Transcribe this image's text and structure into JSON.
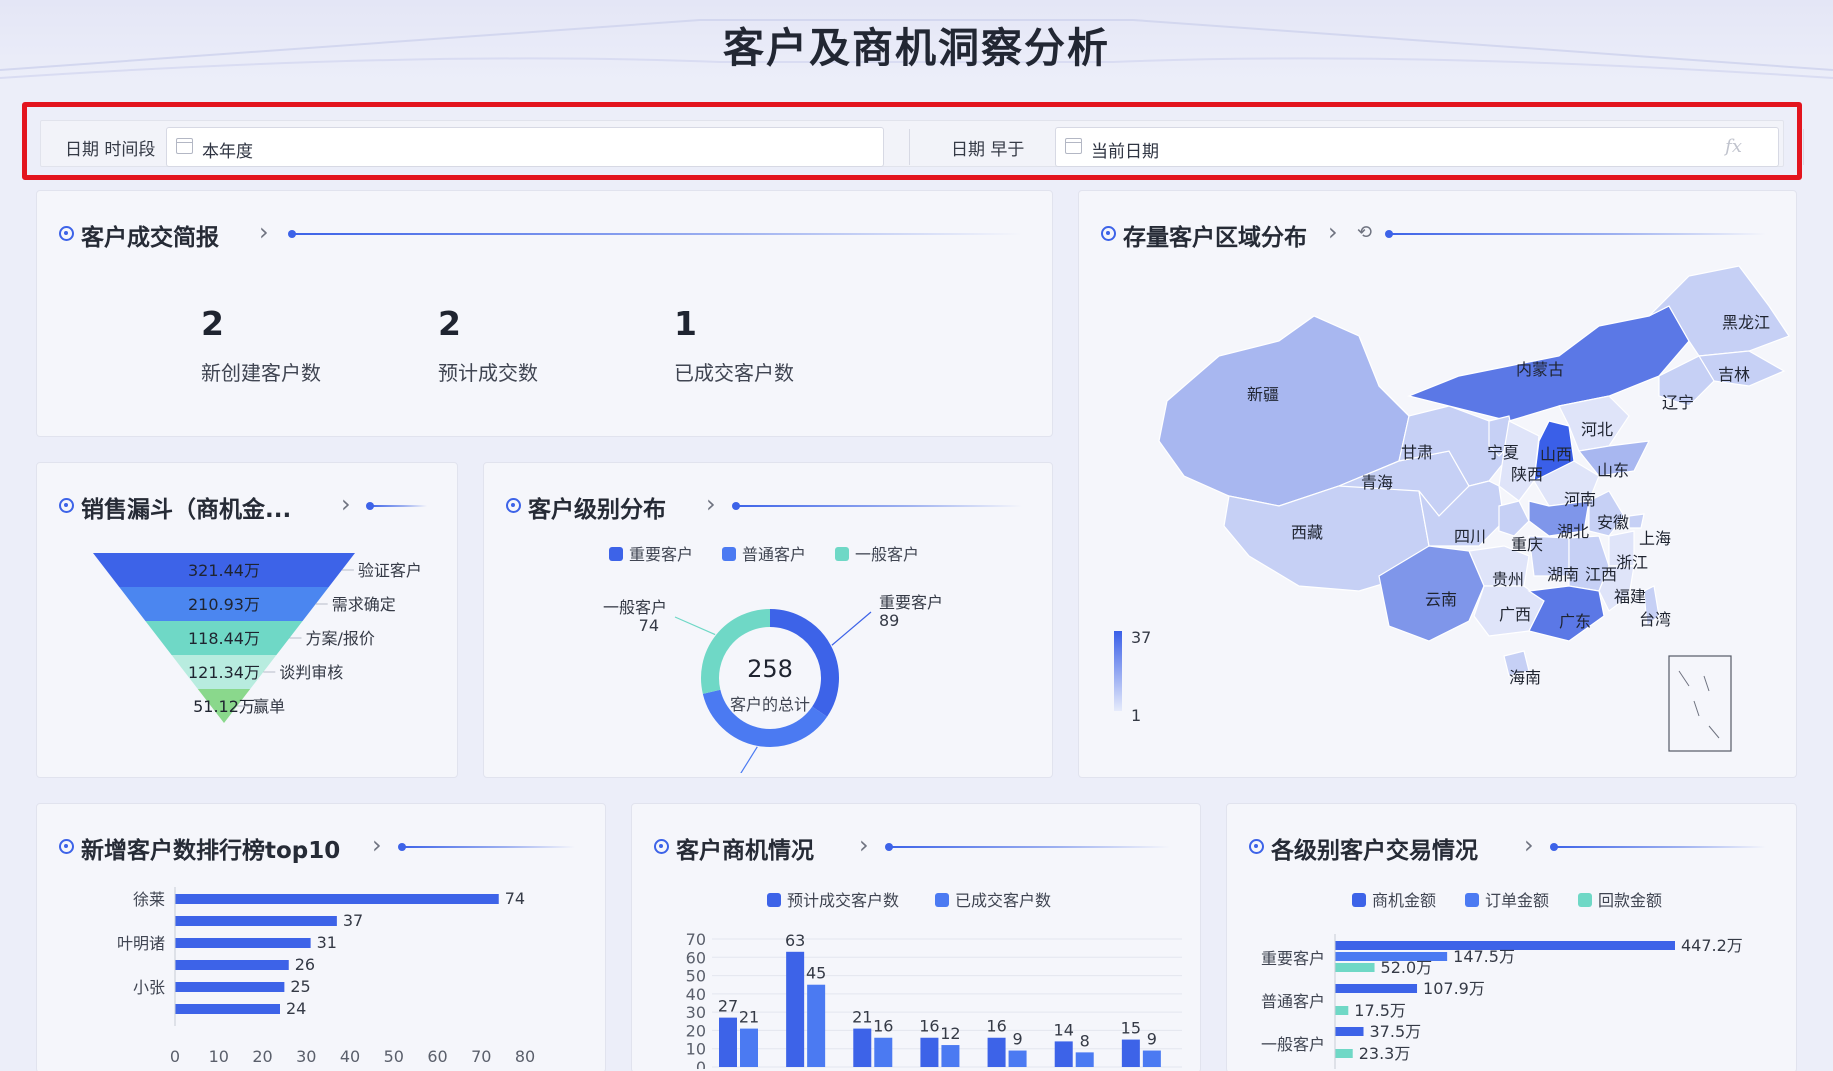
{
  "page": {
    "title": "客户及商机洞察分析"
  },
  "filters": {
    "period_label": "日期 时间段",
    "period_value": "本年度",
    "before_label": "日期 早于",
    "before_value": "当前日期",
    "fx_label": "fx"
  },
  "summary": {
    "title": "客户成交简报",
    "stats": [
      {
        "value": "2",
        "label": "新创建客户数"
      },
      {
        "value": "2",
        "label": "预计成交数"
      },
      {
        "value": "1",
        "label": "已成交客户数"
      }
    ]
  },
  "region": {
    "title": "存量客户区域分布",
    "legend_max": "37",
    "legend_min": "1",
    "provinces": [
      "黑龙江",
      "吉林",
      "辽宁",
      "内蒙古",
      "新疆",
      "河北",
      "山西",
      "山东",
      "甘肃",
      "宁夏",
      "陕西",
      "青海",
      "河南",
      "西藏",
      "四川",
      "重庆",
      "湖北",
      "安徽",
      "上海",
      "浙江",
      "江西",
      "湖南",
      "贵州",
      "云南",
      "广西",
      "广东",
      "福建",
      "台湾",
      "海南"
    ]
  },
  "colors": {
    "accent": "#3d63e8",
    "mid": "#4b7af2",
    "teal": "#6fd8c6",
    "red_frame": "#e3141e"
  },
  "chart_data": [
    {
      "type": "funnel",
      "title": "销售漏斗（商机金...",
      "categories": [
        "验证客户",
        "需求确定",
        "方案/报价",
        "谈判审核",
        "赢单"
      ],
      "value_labels": [
        "321.44万",
        "210.93万",
        "118.44万",
        "121.34万",
        "51.12万"
      ],
      "values": [
        321.44,
        210.93,
        118.44,
        121.34,
        51.12
      ]
    },
    {
      "type": "pie",
      "title": "客户级别分布",
      "categories": [
        "重要客户",
        "普通客户",
        "一般客户"
      ],
      "values": [
        89,
        95,
        74
      ],
      "center_value": "258",
      "center_label": "客户的总计"
    },
    {
      "type": "bar",
      "orientation": "horizontal",
      "title": "新增客户数排行榜top10",
      "categories": [
        "徐莱",
        "",
        "叶明诸",
        "",
        "小张",
        ""
      ],
      "values": [
        74,
        37,
        31,
        26,
        25,
        24
      ],
      "xlim": [
        0,
        80
      ],
      "xticks": [
        "0",
        "10",
        "20",
        "30",
        "40",
        "50",
        "60",
        "70",
        "80"
      ]
    },
    {
      "type": "bar",
      "title": "客户商机情况",
      "ylim": [
        0,
        70
      ],
      "yticks": [
        "70",
        "60",
        "50",
        "40",
        "30",
        "20",
        "10",
        "0"
      ],
      "series": [
        {
          "name": "预计成交客户数",
          "values": [
            27,
            63,
            21,
            16,
            16,
            14,
            15
          ]
        },
        {
          "name": "已成交客户数",
          "values": [
            21,
            45,
            16,
            12,
            9,
            8,
            9
          ]
        }
      ]
    },
    {
      "type": "bar",
      "orientation": "horizontal",
      "title": "各级别客户交易情况",
      "categories": [
        "重要客户",
        "普通客户",
        "一般客户"
      ],
      "series": [
        {
          "name": "商机金额",
          "values": [
            447.2,
            107.9,
            37.5
          ],
          "labels": [
            "447.2万",
            "107.9万",
            "37.5万"
          ]
        },
        {
          "name": "订单金额",
          "values": [
            147.5,
            0,
            0
          ],
          "labels": [
            "147.5万",
            "",
            ""
          ]
        },
        {
          "name": "回款金额",
          "values": [
            52.0,
            17.5,
            23.3
          ],
          "labels": [
            "52.0万",
            "17.5万",
            "23.3万"
          ]
        }
      ]
    }
  ]
}
